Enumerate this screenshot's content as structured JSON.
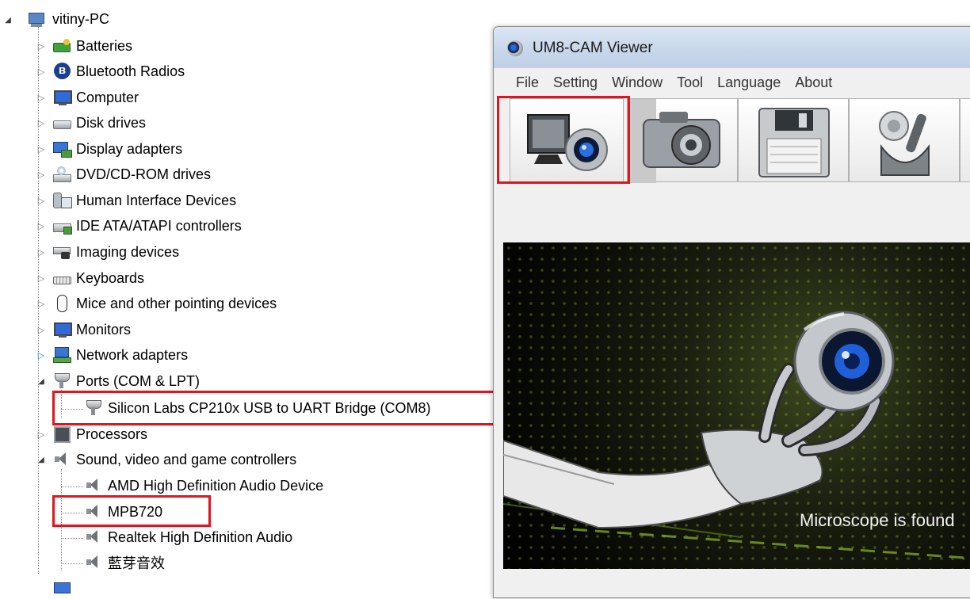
{
  "device_manager": {
    "root": "vitiny-PC",
    "categories": [
      {
        "label": "Batteries",
        "icon": "battery-icon"
      },
      {
        "label": "Bluetooth Radios",
        "icon": "bluetooth-icon"
      },
      {
        "label": "Computer",
        "icon": "computer-icon"
      },
      {
        "label": "Disk drives",
        "icon": "disk-drive-icon"
      },
      {
        "label": "Display adapters",
        "icon": "display-adapter-icon"
      },
      {
        "label": "DVD/CD-ROM drives",
        "icon": "dvd-drive-icon"
      },
      {
        "label": "Human Interface Devices",
        "icon": "hid-icon"
      },
      {
        "label": "IDE ATA/ATAPI controllers",
        "icon": "ide-controller-icon"
      },
      {
        "label": "Imaging devices",
        "icon": "imaging-device-icon"
      },
      {
        "label": "Keyboards",
        "icon": "keyboard-icon"
      },
      {
        "label": "Mice and other pointing devices",
        "icon": "mouse-icon"
      },
      {
        "label": "Monitors",
        "icon": "monitor-icon"
      },
      {
        "label": "Network adapters",
        "icon": "network-adapter-icon"
      },
      {
        "label": "Ports (COM & LPT)",
        "icon": "port-icon",
        "children": [
          "Silicon Labs CP210x USB to UART Bridge (COM8)"
        ]
      },
      {
        "label": "Processors",
        "icon": "processor-icon"
      },
      {
        "label": "Sound, video and game controllers",
        "icon": "speaker-icon",
        "children": [
          "AMD High Definition Audio Device",
          "MPB720",
          "Realtek High Definition Audio",
          "藍芽音效"
        ]
      }
    ]
  },
  "viewer": {
    "title": "UM8-CAM Viewer",
    "menu": [
      "File",
      "Setting",
      "Window",
      "Tool",
      "Language",
      "About"
    ],
    "toolbar": [
      {
        "icon": "monitor-camera-icon"
      },
      {
        "icon": "camera-icon"
      },
      {
        "icon": "floppy-disk-icon"
      },
      {
        "icon": "tools-icon"
      }
    ],
    "status": "Microscope is found"
  },
  "colors": {
    "highlight": "#e3141b",
    "window_title_bg": "#c8d7eb",
    "preview_bg": "#0a0c06"
  }
}
